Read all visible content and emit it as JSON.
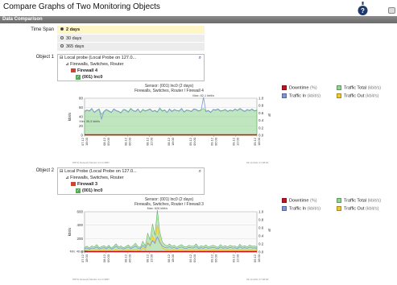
{
  "page": {
    "title": "Compare Graphs of Two Monitoring Objects"
  },
  "section": {
    "title": "Data Comparison"
  },
  "labels": {
    "time_span": "Time Span",
    "object1": "Object 1",
    "object2": "Object 2"
  },
  "time_span": {
    "options": [
      "2 days",
      "30 days",
      "365 days"
    ],
    "selected": "2 days"
  },
  "object1": {
    "probe": "Local probe (Local Probe on 127.0...",
    "group": "Firewalls, Switches, Router",
    "device": "Firewall 4",
    "sensor": "(001) lnc0"
  },
  "object2": {
    "probe": "Local Probe (Local Probe on 127.0...",
    "group": "Firewalls, Switches, Router",
    "device": "Firewall 3",
    "sensor": "(001) lnc0"
  },
  "legend": {
    "items": [
      {
        "label": "Downtime",
        "unit": "(%)",
        "color": "#c0141e"
      },
      {
        "label": "Traffic Total",
        "unit": "(kbit/s)",
        "color": "#8fd68f"
      },
      {
        "label": "Traffic In",
        "unit": "(kbit/s)",
        "color": "#7b96dc"
      },
      {
        "label": "Traffic Out",
        "unit": "(kbit/s)",
        "color": "#f0c830"
      }
    ]
  },
  "chart_data": [
    {
      "type": "area",
      "title": "Sensor: (001) lnc0 (2 days)",
      "subtitle": "Firewalls, Switches, Router / Firewall 4",
      "ylabel": "kbit/s",
      "y2label": "%",
      "ylim": [
        0,
        80
      ],
      "y_ticks": [
        "0",
        "20",
        "40",
        "60",
        "80"
      ],
      "y2lim": [
        0,
        1
      ],
      "y2_ticks": [
        "0.0",
        "0.2",
        "0.4",
        "0.6",
        "0.8",
        "1.0"
      ],
      "x_ticks": [
        "07.12 18:00",
        "08.12 00:00",
        "08.12 06:00",
        "08.12 12:00",
        "08.12 18:00",
        "09.12 00:00",
        "09.12 06:00",
        "09.12 12:00",
        "09.12 18:00"
      ],
      "annotations": {
        "max": "Max: 82,1 kbit/s",
        "min": "Min: 35,3 kbit/s"
      },
      "series": [
        {
          "name": "Traffic Total",
          "values": [
            52,
            55,
            53,
            58,
            50,
            54,
            57,
            45,
            52,
            56,
            53,
            50,
            57,
            54,
            52,
            49,
            56,
            55,
            51,
            58,
            54,
            52,
            57,
            50,
            56,
            53,
            55,
            57,
            52,
            54,
            51,
            59,
            53,
            55,
            50,
            57,
            52,
            56,
            54,
            53,
            58,
            51,
            55,
            54,
            52,
            57,
            56,
            53,
            55,
            58,
            52,
            54,
            50,
            56,
            55,
            57,
            53,
            54,
            56,
            52,
            55,
            53,
            57,
            54,
            58,
            55,
            52,
            56,
            54,
            57,
            53,
            55
          ]
        },
        {
          "name": "Traffic Out",
          "values": [
            0.5,
            0.5,
            0.5,
            0.5,
            0.5,
            0.5,
            0.5,
            0.5,
            0.5,
            0.5,
            0.5,
            0.5,
            0.5,
            0.5,
            0.5,
            0.5,
            0.5,
            0.5,
            0.5,
            0.5,
            0.5,
            0.5,
            0.5,
            0.5,
            0.5,
            0.5,
            0.5,
            0.5,
            0.5,
            0.5,
            0.5,
            0.5,
            0.5,
            0.5,
            0.5,
            0.5,
            0.5,
            0.5,
            0.5,
            0.5,
            0.5,
            0.5,
            0.5,
            0.5,
            0.5,
            0.5,
            0.5,
            0.5,
            0.5,
            0.5,
            0.5,
            0.5,
            0.5,
            0.5,
            0.5,
            0.5,
            0.5,
            0.5,
            0.5,
            0.5,
            0.5,
            0.5,
            0.5,
            0.5,
            0.5,
            0.5,
            0.5,
            0.5,
            0.5,
            0.5,
            0.5,
            0.5
          ]
        },
        {
          "name": "Traffic In",
          "values": [
            51,
            54,
            52,
            57,
            49,
            53,
            56,
            35,
            51,
            55,
            52,
            49,
            56,
            53,
            51,
            48,
            55,
            54,
            50,
            57,
            53,
            51,
            56,
            49,
            55,
            52,
            54,
            56,
            51,
            53,
            50,
            58,
            52,
            54,
            49,
            56,
            51,
            55,
            53,
            52,
            57,
            50,
            54,
            53,
            51,
            56,
            55,
            52,
            54,
            82,
            51,
            53,
            49,
            55,
            54,
            56,
            52,
            53,
            55,
            51,
            54,
            52,
            56,
            53,
            57,
            54,
            51,
            55,
            53,
            56,
            52,
            54
          ]
        }
      ]
    },
    {
      "type": "area",
      "title": "Sensor: (001) lnc0 (2 days)",
      "subtitle": "Firewalls, Switches, Router / Firewall 3",
      "ylabel": "kbit/s",
      "y2label": "%",
      "ylim": [
        0,
        600
      ],
      "y_ticks": [
        "0",
        "200",
        "400",
        "600"
      ],
      "y2lim": [
        0,
        1
      ],
      "y2_ticks": [
        "0.0",
        "0.2",
        "0.4",
        "0.6",
        "0.8",
        "1.0"
      ],
      "x_ticks": [
        "07.12 18:00",
        "08.12 00:00",
        "08.12 06:00",
        "08.12 12:00",
        "08.12 18:00",
        "09.12 00:00",
        "09.12 06:00",
        "09.12 12:00",
        "09.12 18:00"
      ],
      "annotations": {
        "max": "Max: 626 kbit/s",
        "min": "Min: 46 kbit/s"
      },
      "series": [
        {
          "name": "Traffic Total",
          "values": [
            70,
            85,
            60,
            90,
            75,
            110,
            65,
            80,
            95,
            70,
            100,
            60,
            85,
            120,
            75,
            90,
            65,
            80,
            105,
            70,
            95,
            130,
            80,
            70,
            160,
            90,
            280,
            180,
            420,
            250,
            626,
            300,
            150,
            110,
            90,
            120,
            85,
            100,
            70,
            95,
            110,
            80,
            75,
            100,
            90,
            85,
            120,
            70,
            95,
            80,
            105,
            75,
            90,
            100,
            85,
            70,
            110,
            80,
            95,
            75,
            100,
            85,
            90,
            70,
            115,
            80,
            95,
            75,
            105,
            85,
            90,
            80
          ]
        },
        {
          "name": "Traffic Out",
          "values": [
            20,
            25,
            18,
            30,
            22,
            35,
            20,
            25,
            30,
            22,
            28,
            18,
            25,
            35,
            22,
            28,
            20,
            25,
            30,
            22,
            28,
            40,
            25,
            22,
            60,
            30,
            150,
            80,
            250,
            120,
            400,
            160,
            60,
            40,
            30,
            40,
            28,
            32,
            22,
            30,
            35,
            25,
            22,
            32,
            28,
            25,
            38,
            22,
            30,
            25,
            32,
            22,
            28,
            30,
            26,
            22,
            34,
            25,
            30,
            22,
            32,
            26,
            28,
            22,
            36,
            25,
            30,
            22,
            32,
            26,
            28,
            25
          ]
        },
        {
          "name": "Traffic In",
          "values": [
            50,
            60,
            42,
            60,
            53,
            75,
            45,
            55,
            65,
            48,
            72,
            42,
            60,
            85,
            53,
            62,
            45,
            55,
            75,
            48,
            67,
            90,
            55,
            48,
            100,
            60,
            130,
            100,
            170,
            130,
            226,
            140,
            90,
            70,
            60,
            80,
            57,
            68,
            48,
            65,
            75,
            55,
            53,
            68,
            62,
            60,
            82,
            48,
            65,
            55,
            73,
            53,
            62,
            70,
            59,
            48,
            76,
            55,
            65,
            53,
            68,
            59,
            62,
            48,
            79,
            55,
            65,
            53,
            73,
            59,
            62,
            55
          ]
        }
      ]
    }
  ],
  "footnotes": {
    "left": "PRTG Network Monitor 9.2.0.3897",
    "right": "09.12.2011 17:08:00"
  }
}
